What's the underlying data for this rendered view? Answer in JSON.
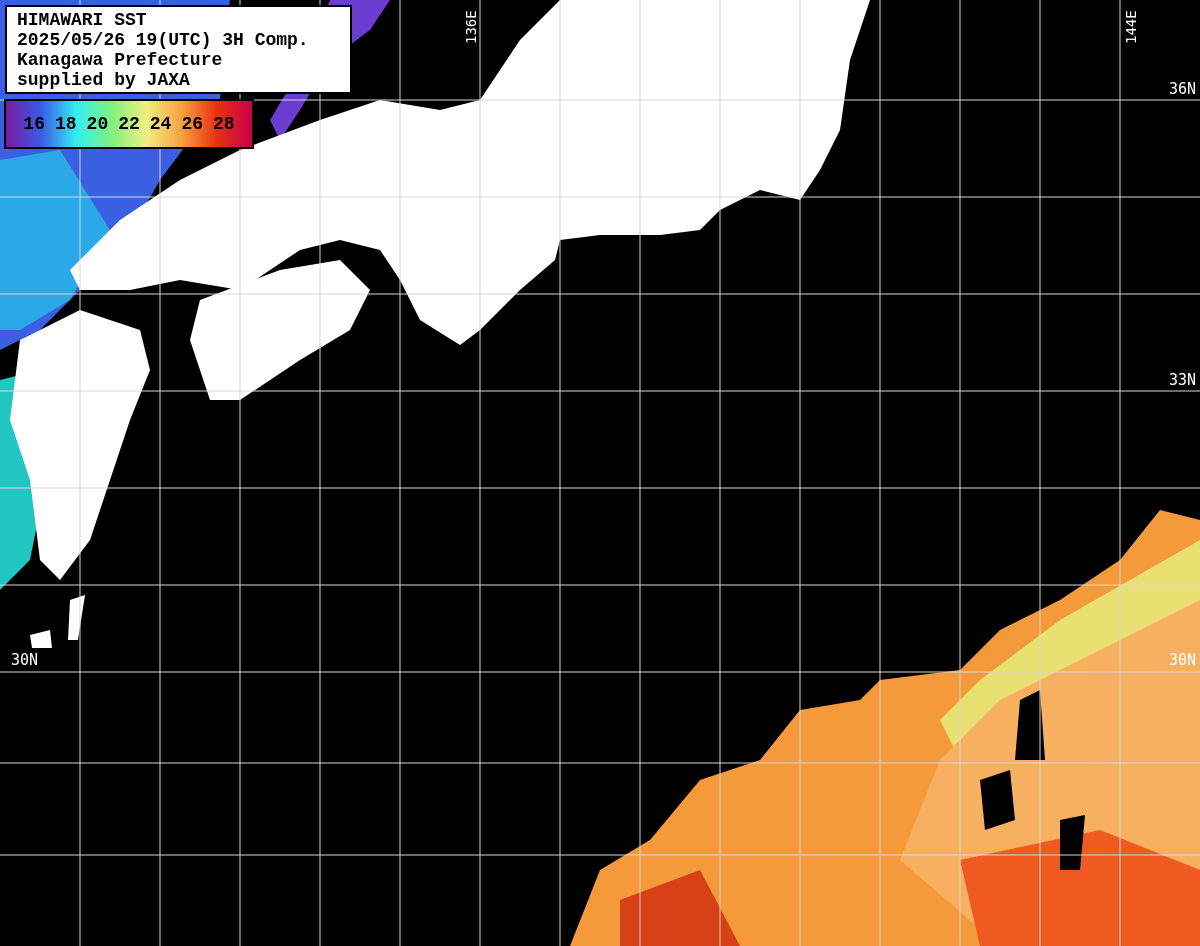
{
  "info_box": {
    "lines": [
      "HIMAWARI SST",
      "2025/05/26 19(UTC) 3H Comp.",
      "Kanagawa Prefecture",
      "supplied by JAXA"
    ]
  },
  "legend": {
    "ticks": [
      "16",
      "18",
      "20",
      "22",
      "24",
      "26",
      "28"
    ]
  },
  "longitude_labels": [
    {
      "text": "136E",
      "kind": "top"
    },
    {
      "text": "144E",
      "kind": "top"
    }
  ],
  "latitude_labels": [
    {
      "text": "36N",
      "kind": "right"
    },
    {
      "text": "33N",
      "kind": "right"
    },
    {
      "text": "30N",
      "kind": "left"
    },
    {
      "text": "30N",
      "kind": "right"
    }
  ]
}
